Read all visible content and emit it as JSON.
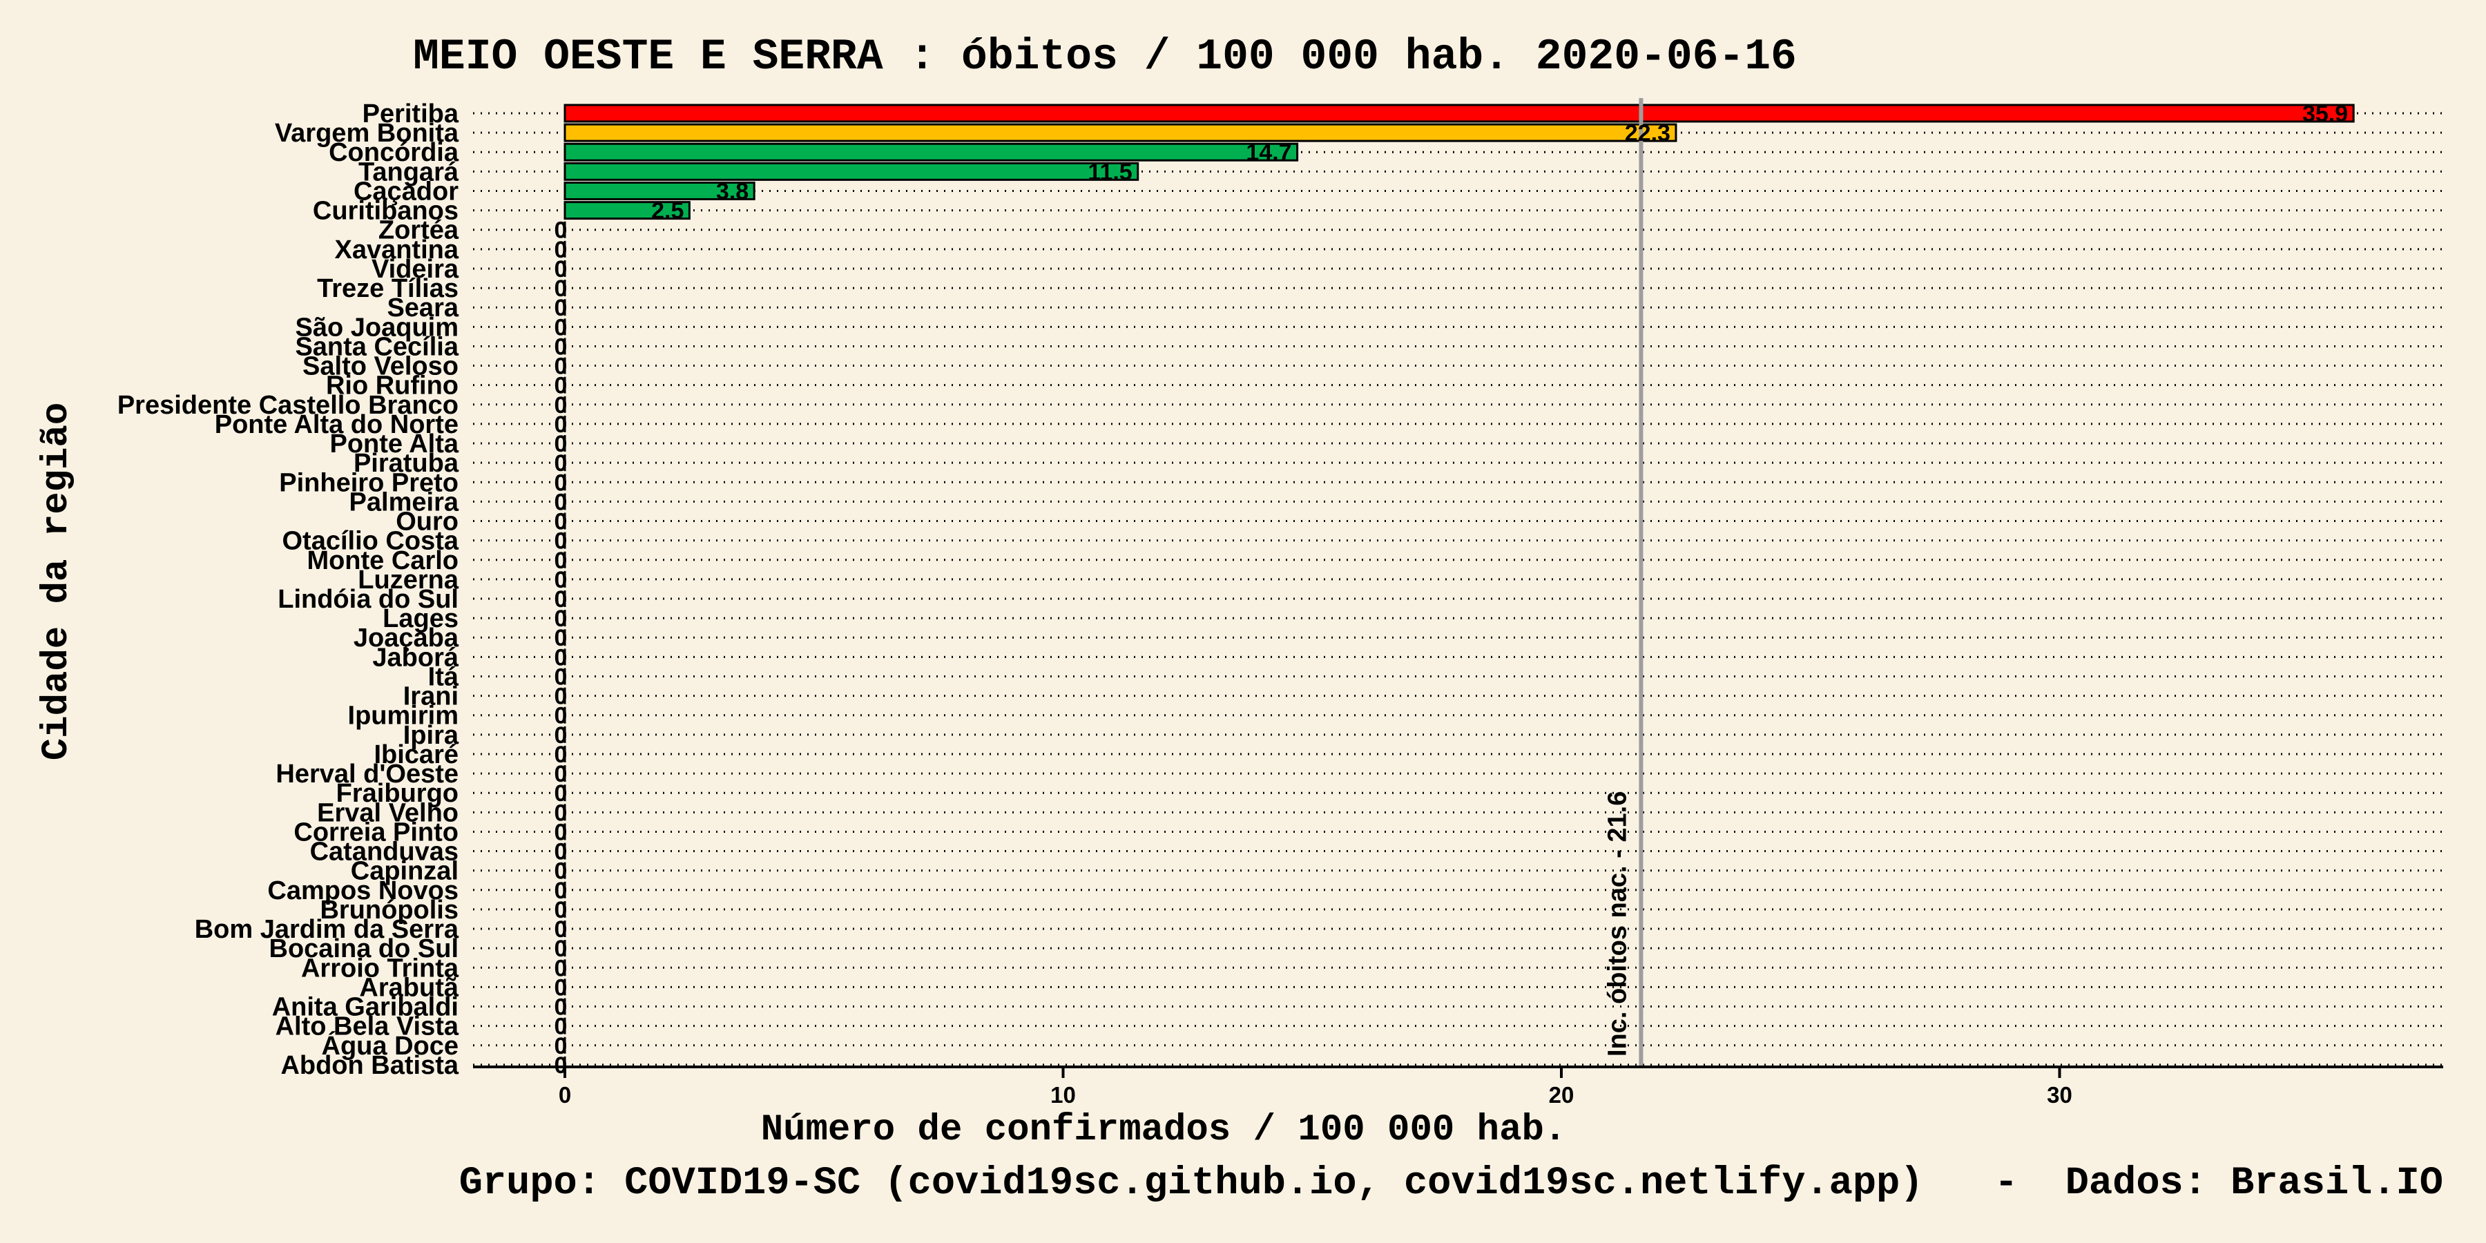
{
  "chart_data": {
    "type": "bar",
    "orientation": "horizontal",
    "title": "MEIO OESTE E SERRA : óbitos / 100 000 hab. 2020-06-16",
    "xlabel": "Número de confirmados / 100 000 hab.",
    "ylabel": "Cidade da região",
    "caption": "Grupo: COVID19-SC (covid19sc.github.io, covid19sc.netlify.app)   -  Dados: Brasil.IO",
    "xlim": [
      -1.8,
      37.8
    ],
    "xticks": [
      0,
      10,
      20,
      30
    ],
    "xtick_labels": [
      "0",
      "10",
      "20",
      "30"
    ],
    "grid": "dotted",
    "reference_line": {
      "value": 21.6,
      "label": "Inc. óbitos nac. - 21.6"
    },
    "colors": {
      "high": "#ff0000",
      "medium": "#ffbf00",
      "low": "#00b050",
      "background": "#f9f2e3",
      "refline": "#9e9e9e"
    },
    "categories": [
      "Peritiba",
      "Vargem Bonita",
      "Concórdia",
      "Tangará",
      "Caçador",
      "Curitibanos",
      "Zortéa",
      "Xavantina",
      "Videira",
      "Treze Tílias",
      "Seara",
      "São Joaquim",
      "Santa Cecília",
      "Salto Veloso",
      "Rio Rufino",
      "Presidente Castello Branco",
      "Ponte Alta do Norte",
      "Ponte Alta",
      "Piratuba",
      "Pinheiro Preto",
      "Palmeira",
      "Ouro",
      "Otacílio Costa",
      "Monte Carlo",
      "Luzerna",
      "Lindóia do Sul",
      "Lages",
      "Joaçaba",
      "Jaborá",
      "Itá",
      "Irani",
      "Ipumirim",
      "Ipira",
      "Ibicaré",
      "Herval d'Oeste",
      "Fraiburgo",
      "Erval Velho",
      "Correia Pinto",
      "Catanduvas",
      "Capinzal",
      "Campos Novos",
      "Brunópolis",
      "Bom Jardim da Serra",
      "Bocaina do Sul",
      "Arroio Trinta",
      "Arabutã",
      "Anita Garibaldi",
      "Alto Bela Vista",
      "Água Doce",
      "Abdon Batista"
    ],
    "values": [
      35.9,
      22.3,
      14.7,
      11.5,
      3.8,
      2.5,
      0,
      0,
      0,
      0,
      0,
      0,
      0,
      0,
      0,
      0,
      0,
      0,
      0,
      0,
      0,
      0,
      0,
      0,
      0,
      0,
      0,
      0,
      0,
      0,
      0,
      0,
      0,
      0,
      0,
      0,
      0,
      0,
      0,
      0,
      0,
      0,
      0,
      0,
      0,
      0,
      0,
      0,
      0,
      0
    ],
    "value_labels": [
      "35.9",
      "22.3",
      "14.7",
      "11.5",
      "3.8",
      "2.5",
      "0",
      "0",
      "0",
      "0",
      "0",
      "0",
      "0",
      "0",
      "0",
      "0",
      "0",
      "0",
      "0",
      "0",
      "0",
      "0",
      "0",
      "0",
      "0",
      "0",
      "0",
      "0",
      "0",
      "0",
      "0",
      "0",
      "0",
      "0",
      "0",
      "0",
      "0",
      "0",
      "0",
      "0",
      "0",
      "0",
      "0",
      "0",
      "0",
      "0",
      "0",
      "0",
      "0",
      "0"
    ],
    "bar_colors": [
      "#ff0000",
      "#ffbf00",
      "#00b050",
      "#00b050",
      "#00b050",
      "#00b050",
      "#00b050",
      "#00b050",
      "#00b050",
      "#00b050",
      "#00b050",
      "#00b050",
      "#00b050",
      "#00b050",
      "#00b050",
      "#00b050",
      "#00b050",
      "#00b050",
      "#00b050",
      "#00b050",
      "#00b050",
      "#00b050",
      "#00b050",
      "#00b050",
      "#00b050",
      "#00b050",
      "#00b050",
      "#00b050",
      "#00b050",
      "#00b050",
      "#00b050",
      "#00b050",
      "#00b050",
      "#00b050",
      "#00b050",
      "#00b050",
      "#00b050",
      "#00b050",
      "#00b050",
      "#00b050",
      "#00b050",
      "#00b050",
      "#00b050",
      "#00b050",
      "#00b050",
      "#00b050",
      "#00b050",
      "#00b050",
      "#00b050",
      "#00b050"
    ]
  }
}
